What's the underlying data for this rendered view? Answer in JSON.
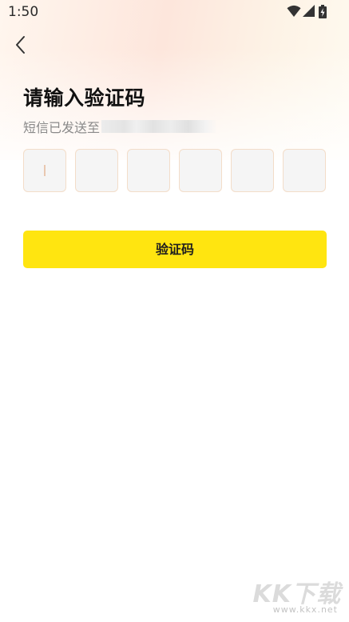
{
  "status_bar": {
    "time": "1:50",
    "icons": [
      "wifi-icon",
      "signal-icon",
      "battery-charging-icon"
    ]
  },
  "header": {
    "back_icon": "chevron-left-icon"
  },
  "main": {
    "title": "请输入验证码",
    "sms_prefix": "短信已发送至",
    "code_boxes": [
      "",
      "",
      "",
      "",
      "",
      ""
    ],
    "submit_label": "验证码"
  },
  "watermark": {
    "main": "KK下载",
    "url": "www.kkx.net"
  },
  "colors": {
    "accent_button": "#ffe510",
    "code_box_border": "#f3ddc9",
    "code_box_fill": "#f5f5f5"
  }
}
